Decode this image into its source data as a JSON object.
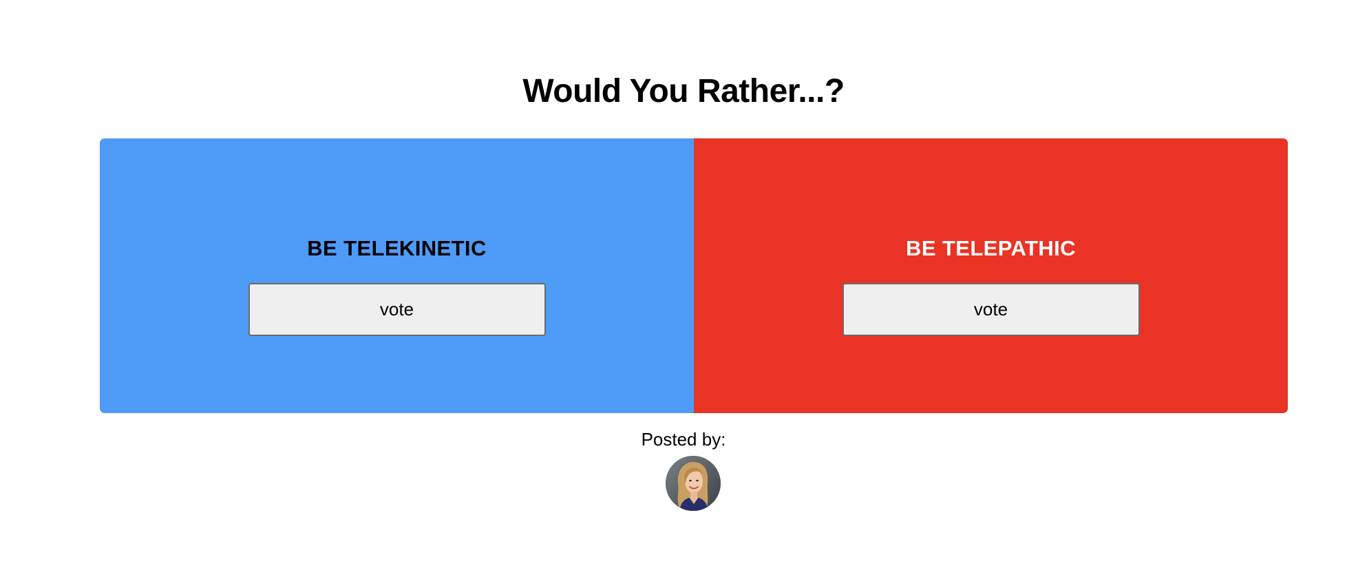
{
  "header": {
    "title": "Would You Rather...?"
  },
  "options": [
    {
      "label": "BE TELEKINETIC",
      "vote_label": "vote",
      "color": "#4f9bf8",
      "text_color": "#000000"
    },
    {
      "label": "BE TELEPATHIC",
      "vote_label": "vote",
      "color": "#e93324",
      "text_color": "#ffffff"
    }
  ],
  "footer": {
    "posted_by_label": "Posted by:",
    "avatar_icon": "user-avatar-photo"
  }
}
